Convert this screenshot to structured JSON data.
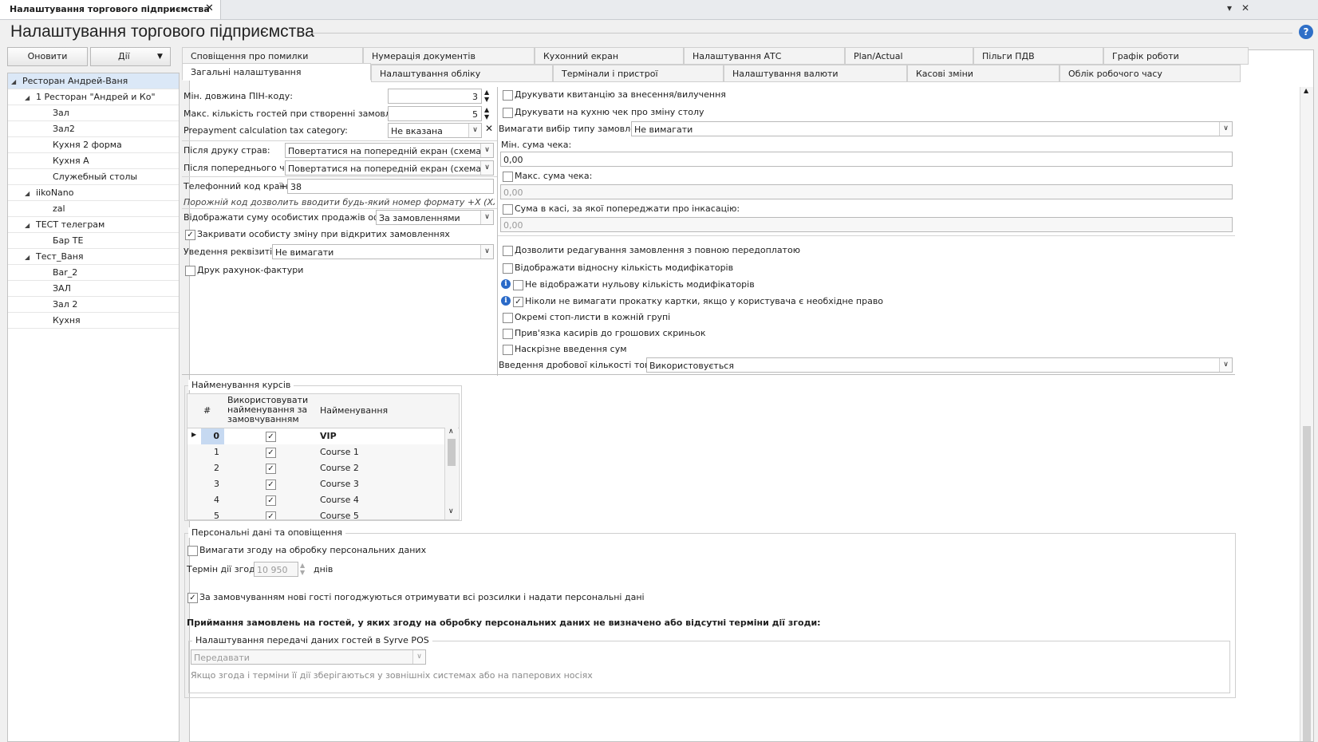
{
  "window": {
    "doc_tab": "Налаштування торгового підприємства",
    "page_title": "Налаштування торгового підприємства"
  },
  "toolbar": {
    "refresh": "Оновити",
    "actions": "Дії"
  },
  "tree": [
    {
      "label": "Ресторан Андрей-Ваня",
      "level": 0,
      "expander": "◢"
    },
    {
      "label": "1 Ресторан \"Андрей и Ко\"",
      "level": 1,
      "expander": "◢"
    },
    {
      "label": "Зал",
      "level": 2,
      "expander": ""
    },
    {
      "label": "Зал2",
      "level": 2,
      "expander": ""
    },
    {
      "label": "Кухня 2 форма",
      "level": 2,
      "expander": ""
    },
    {
      "label": "Кухня А",
      "level": 2,
      "expander": ""
    },
    {
      "label": "Служебный столы",
      "level": 2,
      "expander": ""
    },
    {
      "label": "iikoNano",
      "level": 1,
      "expander": "◢"
    },
    {
      "label": "zal",
      "level": 2,
      "expander": ""
    },
    {
      "label": "ТЕСТ телеграм",
      "level": 1,
      "expander": "◢"
    },
    {
      "label": "Бар ТЕ",
      "level": 2,
      "expander": ""
    },
    {
      "label": "Тест_Ваня",
      "level": 1,
      "expander": "◢"
    },
    {
      "label": "Bar_2",
      "level": 2,
      "expander": ""
    },
    {
      "label": "ЗАЛ",
      "level": 2,
      "expander": ""
    },
    {
      "label": "Зал 2",
      "level": 2,
      "expander": ""
    },
    {
      "label": "Кухня",
      "level": 2,
      "expander": ""
    }
  ],
  "tabs_row1": [
    "Сповіщення про помилки",
    "Нумерація документів",
    "Кухонний екран",
    "Налаштування АТС",
    "Plan/Actual",
    "Пільги ПДВ",
    "Графік роботи"
  ],
  "tabs_row2": [
    "Загальні налаштування",
    "Налаштування обліку",
    "Термінали і пристрої",
    "Налаштування валюти",
    "Касові зміни",
    "Облік робочого часу"
  ],
  "left": {
    "pin_label": "Мін. довжина ПІН-коду:",
    "pin_value": "3",
    "guests_label": "Макс. кількість гостей при створенні замовлення:",
    "guests_value": "5",
    "prepay_label": "Prepayment calculation tax category:",
    "prepay_value": "Не вказана",
    "after_print_label": "Після друку страв:",
    "after_print_value": "Повертатися на попередній екран (схема зали,...",
    "after_precheck_label": "Після попереднього чека:",
    "after_precheck_value": "Повертатися на попередній екран (схема зали,...",
    "phone_label": "Телефонний код країни:",
    "phone_plus": "+",
    "phone_value": "38",
    "phone_hint": "Порожній код дозволить вводити будь-який номер формату +X (XXX) XXX-XX-XX",
    "personal_sales_label": "Відображати суму особистих продажів офіціанта:",
    "personal_sales_value": "За замовленнями",
    "close_shift_label": "Закривати особисту зміну при відкритих замовленнях",
    "requisites_label": "Уведення реквізитів:",
    "requisites_value": "Не вимагати",
    "invoice_label": "Друк рахунок-фактури"
  },
  "right": {
    "print_receipt": "Друкувати квитанцію за внесення/вилучення",
    "print_kitchen": "Друкувати на кухню чек про зміну столу",
    "order_type_label": "Вимагати вибір типу замовлення:",
    "order_type_value": "Не вимагати",
    "min_sum_label": "Мін. сума чека:",
    "min_sum_value": "0,00",
    "max_sum_label": "Макс. сума чека:",
    "max_sum_value": "0,00",
    "cash_label": "Сума в касі, за якої попереджати про інкасацію:",
    "cash_value": "0,00",
    "opt_edit_prepaid": "Дозволити редагування замовлення з повною передоплатою",
    "opt_relative_mod": "Відображати відносну кількість модифікаторів",
    "opt_zero_mod": "Не відображати нульову кількість модифікаторів",
    "opt_card": "Ніколи не вимагати прокатку картки, якщо у користувача є необхідне право",
    "opt_stoplists": "Окремі стоп-листи в кожній групі",
    "opt_cashiers": "Прив'язка касирів до грошових скриньок",
    "opt_through": "Наскрізне введення сум",
    "fraction_label": "Введення дробової кількості товарів:",
    "fraction_value": "Використовується"
  },
  "courses": {
    "title": "Найменування курсів",
    "col_num": "#",
    "col_use": "Використовувати найменування за замовчуванням",
    "col_name": "Найменування",
    "rows": [
      {
        "num": "0",
        "name": "VIP"
      },
      {
        "num": "1",
        "name": "Course 1"
      },
      {
        "num": "2",
        "name": "Course 2"
      },
      {
        "num": "3",
        "name": "Course 3"
      },
      {
        "num": "4",
        "name": "Course 4"
      },
      {
        "num": "5",
        "name": "Course 5"
      }
    ]
  },
  "personal": {
    "title": "Персональні дані та оповіщення",
    "consent": "Вимагати згоду на обробку персональних даних",
    "term_label": "Термін дії згоди:",
    "term_value": "10 950",
    "term_unit": "днів",
    "default_consent": "За замовчуванням нові гості погоджуються отримувати всі розсилки і надати персональні дані",
    "bold_note": "Приймання замовлень на гостей, у яких згоду на обробку персональних даних не визначено або відсутні терміни дії згоди:",
    "transfer_title": "Налаштування передачі даних гостей в Syrve POS",
    "transfer_value": "Передавати",
    "transfer_hint": "Якщо згода і терміни її дії зберігаються у зовнішніх системах або на паперових носіях"
  }
}
